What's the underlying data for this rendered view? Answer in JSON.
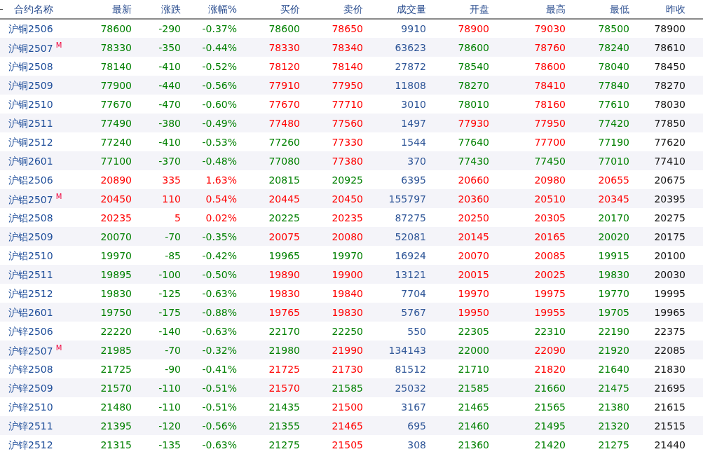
{
  "columns": [
    {
      "label": "合约名称",
      "kind": "name"
    },
    {
      "label": "最新",
      "kind": "price"
    },
    {
      "label": "涨跌",
      "kind": "price"
    },
    {
      "label": "涨幅%",
      "kind": "price"
    },
    {
      "label": "买价",
      "kind": "price"
    },
    {
      "label": "卖价",
      "kind": "price"
    },
    {
      "label": "成交量",
      "kind": "volume"
    },
    {
      "label": "开盘",
      "kind": "price"
    },
    {
      "label": "最高",
      "kind": "price"
    },
    {
      "label": "最低",
      "kind": "price"
    },
    {
      "label": "昨收",
      "kind": "close"
    }
  ],
  "rows": [
    {
      "name": "沪铜2506",
      "cells": [
        {
          "text": "78600",
          "color": "#008000"
        },
        {
          "text": "-290",
          "color": "#008000"
        },
        {
          "text": "-0.37%",
          "color": "#008000"
        },
        {
          "text": "78600",
          "color": "#008000"
        },
        {
          "text": "78650",
          "color": "#ff0000"
        },
        {
          "text": "9910"
        },
        {
          "text": "78900",
          "color": "#ff0000"
        },
        {
          "text": "79030",
          "color": "#ff0000"
        },
        {
          "text": "78500",
          "color": "#008000"
        },
        {
          "text": "78900"
        }
      ]
    },
    {
      "name": "沪铜2507",
      "marker": "M",
      "cells": [
        {
          "text": "78330",
          "color": "#008000"
        },
        {
          "text": "-350",
          "color": "#008000"
        },
        {
          "text": "-0.44%",
          "color": "#008000"
        },
        {
          "text": "78330",
          "color": "#ff0000"
        },
        {
          "text": "78340",
          "color": "#ff0000"
        },
        {
          "text": "63623"
        },
        {
          "text": "78600",
          "color": "#008000"
        },
        {
          "text": "78760",
          "color": "#ff0000"
        },
        {
          "text": "78240",
          "color": "#008000"
        },
        {
          "text": "78610"
        }
      ]
    },
    {
      "name": "沪铜2508",
      "cells": [
        {
          "text": "78140",
          "color": "#008000"
        },
        {
          "text": "-410",
          "color": "#008000"
        },
        {
          "text": "-0.52%",
          "color": "#008000"
        },
        {
          "text": "78120",
          "color": "#ff0000"
        },
        {
          "text": "78140",
          "color": "#ff0000"
        },
        {
          "text": "27872"
        },
        {
          "text": "78540",
          "color": "#008000"
        },
        {
          "text": "78600",
          "color": "#ff0000"
        },
        {
          "text": "78040",
          "color": "#008000"
        },
        {
          "text": "78450"
        }
      ]
    },
    {
      "name": "沪铜2509",
      "cells": [
        {
          "text": "77900",
          "color": "#008000"
        },
        {
          "text": "-440",
          "color": "#008000"
        },
        {
          "text": "-0.56%",
          "color": "#008000"
        },
        {
          "text": "77910",
          "color": "#ff0000"
        },
        {
          "text": "77950",
          "color": "#ff0000"
        },
        {
          "text": "11808"
        },
        {
          "text": "78270",
          "color": "#008000"
        },
        {
          "text": "78410",
          "color": "#ff0000"
        },
        {
          "text": "77840",
          "color": "#008000"
        },
        {
          "text": "78270"
        }
      ]
    },
    {
      "name": "沪铜2510",
      "cells": [
        {
          "text": "77670",
          "color": "#008000"
        },
        {
          "text": "-470",
          "color": "#008000"
        },
        {
          "text": "-0.60%",
          "color": "#008000"
        },
        {
          "text": "77670",
          "color": "#ff0000"
        },
        {
          "text": "77710",
          "color": "#ff0000"
        },
        {
          "text": "3010"
        },
        {
          "text": "78010",
          "color": "#008000"
        },
        {
          "text": "78160",
          "color": "#ff0000"
        },
        {
          "text": "77610",
          "color": "#008000"
        },
        {
          "text": "78030"
        }
      ]
    },
    {
      "name": "沪铜2511",
      "cells": [
        {
          "text": "77490",
          "color": "#008000"
        },
        {
          "text": "-380",
          "color": "#008000"
        },
        {
          "text": "-0.49%",
          "color": "#008000"
        },
        {
          "text": "77480",
          "color": "#ff0000"
        },
        {
          "text": "77560",
          "color": "#ff0000"
        },
        {
          "text": "1497"
        },
        {
          "text": "77930",
          "color": "#ff0000"
        },
        {
          "text": "77950",
          "color": "#ff0000"
        },
        {
          "text": "77420",
          "color": "#008000"
        },
        {
          "text": "77850"
        }
      ]
    },
    {
      "name": "沪铜2512",
      "cells": [
        {
          "text": "77240",
          "color": "#008000"
        },
        {
          "text": "-410",
          "color": "#008000"
        },
        {
          "text": "-0.53%",
          "color": "#008000"
        },
        {
          "text": "77260",
          "color": "#008000"
        },
        {
          "text": "77330",
          "color": "#ff0000"
        },
        {
          "text": "1544"
        },
        {
          "text": "77640",
          "color": "#008000"
        },
        {
          "text": "77700",
          "color": "#ff0000"
        },
        {
          "text": "77190",
          "color": "#008000"
        },
        {
          "text": "77620"
        }
      ]
    },
    {
      "name": "沪铜2601",
      "cells": [
        {
          "text": "77100",
          "color": "#008000"
        },
        {
          "text": "-370",
          "color": "#008000"
        },
        {
          "text": "-0.48%",
          "color": "#008000"
        },
        {
          "text": "77080",
          "color": "#008000"
        },
        {
          "text": "77380",
          "color": "#ff0000"
        },
        {
          "text": "370"
        },
        {
          "text": "77430",
          "color": "#008000"
        },
        {
          "text": "77450",
          "color": "#008000"
        },
        {
          "text": "77010",
          "color": "#008000"
        },
        {
          "text": "77410"
        }
      ]
    },
    {
      "name": "沪铝2506",
      "cells": [
        {
          "text": "20890",
          "color": "#ff0000"
        },
        {
          "text": "335",
          "color": "#ff0000"
        },
        {
          "text": "1.63%",
          "color": "#ff0000"
        },
        {
          "text": "20815",
          "color": "#008000"
        },
        {
          "text": "20925",
          "color": "#008000"
        },
        {
          "text": "6395"
        },
        {
          "text": "20660",
          "color": "#ff0000"
        },
        {
          "text": "20980",
          "color": "#ff0000"
        },
        {
          "text": "20655",
          "color": "#ff0000"
        },
        {
          "text": "20675"
        }
      ]
    },
    {
      "name": "沪铝2507",
      "marker": "M",
      "cells": [
        {
          "text": "20450",
          "color": "#ff0000"
        },
        {
          "text": "110",
          "color": "#ff0000"
        },
        {
          "text": "0.54%",
          "color": "#ff0000"
        },
        {
          "text": "20445",
          "color": "#ff0000"
        },
        {
          "text": "20450",
          "color": "#ff0000"
        },
        {
          "text": "155797"
        },
        {
          "text": "20360",
          "color": "#ff0000"
        },
        {
          "text": "20510",
          "color": "#ff0000"
        },
        {
          "text": "20345",
          "color": "#ff0000"
        },
        {
          "text": "20395"
        }
      ]
    },
    {
      "name": "沪铝2508",
      "cells": [
        {
          "text": "20235",
          "color": "#ff0000"
        },
        {
          "text": "5",
          "color": "#ff0000"
        },
        {
          "text": "0.02%",
          "color": "#ff0000"
        },
        {
          "text": "20225",
          "color": "#008000"
        },
        {
          "text": "20235",
          "color": "#ff0000"
        },
        {
          "text": "87275"
        },
        {
          "text": "20250",
          "color": "#ff0000"
        },
        {
          "text": "20305",
          "color": "#ff0000"
        },
        {
          "text": "20170",
          "color": "#008000"
        },
        {
          "text": "20275"
        }
      ]
    },
    {
      "name": "沪铝2509",
      "cells": [
        {
          "text": "20070",
          "color": "#008000"
        },
        {
          "text": "-70",
          "color": "#008000"
        },
        {
          "text": "-0.35%",
          "color": "#008000"
        },
        {
          "text": "20075",
          "color": "#ff0000"
        },
        {
          "text": "20080",
          "color": "#ff0000"
        },
        {
          "text": "52081"
        },
        {
          "text": "20145",
          "color": "#ff0000"
        },
        {
          "text": "20165",
          "color": "#ff0000"
        },
        {
          "text": "20020",
          "color": "#008000"
        },
        {
          "text": "20175"
        }
      ]
    },
    {
      "name": "沪铝2510",
      "cells": [
        {
          "text": "19970",
          "color": "#008000"
        },
        {
          "text": "-85",
          "color": "#008000"
        },
        {
          "text": "-0.42%",
          "color": "#008000"
        },
        {
          "text": "19965",
          "color": "#008000"
        },
        {
          "text": "19970",
          "color": "#008000"
        },
        {
          "text": "16924"
        },
        {
          "text": "20070",
          "color": "#ff0000"
        },
        {
          "text": "20085",
          "color": "#ff0000"
        },
        {
          "text": "19915",
          "color": "#008000"
        },
        {
          "text": "20100"
        }
      ]
    },
    {
      "name": "沪铝2511",
      "cells": [
        {
          "text": "19895",
          "color": "#008000"
        },
        {
          "text": "-100",
          "color": "#008000"
        },
        {
          "text": "-0.50%",
          "color": "#008000"
        },
        {
          "text": "19890",
          "color": "#ff0000"
        },
        {
          "text": "19900",
          "color": "#ff0000"
        },
        {
          "text": "13121"
        },
        {
          "text": "20015",
          "color": "#ff0000"
        },
        {
          "text": "20025",
          "color": "#ff0000"
        },
        {
          "text": "19830",
          "color": "#008000"
        },
        {
          "text": "20030"
        }
      ]
    },
    {
      "name": "沪铝2512",
      "cells": [
        {
          "text": "19830",
          "color": "#008000"
        },
        {
          "text": "-125",
          "color": "#008000"
        },
        {
          "text": "-0.63%",
          "color": "#008000"
        },
        {
          "text": "19830",
          "color": "#ff0000"
        },
        {
          "text": "19840",
          "color": "#ff0000"
        },
        {
          "text": "7704"
        },
        {
          "text": "19970",
          "color": "#ff0000"
        },
        {
          "text": "19975",
          "color": "#ff0000"
        },
        {
          "text": "19770",
          "color": "#008000"
        },
        {
          "text": "19995"
        }
      ]
    },
    {
      "name": "沪铝2601",
      "cells": [
        {
          "text": "19750",
          "color": "#008000"
        },
        {
          "text": "-175",
          "color": "#008000"
        },
        {
          "text": "-0.88%",
          "color": "#008000"
        },
        {
          "text": "19765",
          "color": "#ff0000"
        },
        {
          "text": "19830",
          "color": "#ff0000"
        },
        {
          "text": "5767"
        },
        {
          "text": "19950",
          "color": "#ff0000"
        },
        {
          "text": "19955",
          "color": "#ff0000"
        },
        {
          "text": "19705",
          "color": "#008000"
        },
        {
          "text": "19965"
        }
      ]
    },
    {
      "name": "沪锌2506",
      "cells": [
        {
          "text": "22220",
          "color": "#008000"
        },
        {
          "text": "-140",
          "color": "#008000"
        },
        {
          "text": "-0.63%",
          "color": "#008000"
        },
        {
          "text": "22170",
          "color": "#008000"
        },
        {
          "text": "22250",
          "color": "#008000"
        },
        {
          "text": "550"
        },
        {
          "text": "22305",
          "color": "#008000"
        },
        {
          "text": "22310",
          "color": "#008000"
        },
        {
          "text": "22190",
          "color": "#008000"
        },
        {
          "text": "22375"
        }
      ]
    },
    {
      "name": "沪锌2507",
      "marker": "M",
      "cells": [
        {
          "text": "21985",
          "color": "#008000"
        },
        {
          "text": "-70",
          "color": "#008000"
        },
        {
          "text": "-0.32%",
          "color": "#008000"
        },
        {
          "text": "21980",
          "color": "#008000"
        },
        {
          "text": "21990",
          "color": "#ff0000"
        },
        {
          "text": "134143"
        },
        {
          "text": "22000",
          "color": "#008000"
        },
        {
          "text": "22090",
          "color": "#ff0000"
        },
        {
          "text": "21920",
          "color": "#008000"
        },
        {
          "text": "22085"
        }
      ]
    },
    {
      "name": "沪锌2508",
      "cells": [
        {
          "text": "21725",
          "color": "#008000"
        },
        {
          "text": "-90",
          "color": "#008000"
        },
        {
          "text": "-0.41%",
          "color": "#008000"
        },
        {
          "text": "21725",
          "color": "#ff0000"
        },
        {
          "text": "21730",
          "color": "#ff0000"
        },
        {
          "text": "81512"
        },
        {
          "text": "21710",
          "color": "#008000"
        },
        {
          "text": "21820",
          "color": "#ff0000"
        },
        {
          "text": "21640",
          "color": "#008000"
        },
        {
          "text": "21830"
        }
      ]
    },
    {
      "name": "沪锌2509",
      "cells": [
        {
          "text": "21570",
          "color": "#008000"
        },
        {
          "text": "-110",
          "color": "#008000"
        },
        {
          "text": "-0.51%",
          "color": "#008000"
        },
        {
          "text": "21570",
          "color": "#ff0000"
        },
        {
          "text": "21585",
          "color": "#008000"
        },
        {
          "text": "25032"
        },
        {
          "text": "21585",
          "color": "#008000"
        },
        {
          "text": "21660",
          "color": "#008000"
        },
        {
          "text": "21475",
          "color": "#008000"
        },
        {
          "text": "21695"
        }
      ]
    },
    {
      "name": "沪锌2510",
      "cells": [
        {
          "text": "21480",
          "color": "#008000"
        },
        {
          "text": "-110",
          "color": "#008000"
        },
        {
          "text": "-0.51%",
          "color": "#008000"
        },
        {
          "text": "21435",
          "color": "#008000"
        },
        {
          "text": "21500",
          "color": "#ff0000"
        },
        {
          "text": "3167"
        },
        {
          "text": "21465",
          "color": "#008000"
        },
        {
          "text": "21565",
          "color": "#008000"
        },
        {
          "text": "21380",
          "color": "#008000"
        },
        {
          "text": "21615"
        }
      ]
    },
    {
      "name": "沪锌2511",
      "cells": [
        {
          "text": "21395",
          "color": "#008000"
        },
        {
          "text": "-120",
          "color": "#008000"
        },
        {
          "text": "-0.56%",
          "color": "#008000"
        },
        {
          "text": "21355",
          "color": "#008000"
        },
        {
          "text": "21465",
          "color": "#ff0000"
        },
        {
          "text": "695"
        },
        {
          "text": "21460",
          "color": "#008000"
        },
        {
          "text": "21495",
          "color": "#008000"
        },
        {
          "text": "21320",
          "color": "#008000"
        },
        {
          "text": "21515"
        }
      ]
    },
    {
      "name": "沪锌2512",
      "cells": [
        {
          "text": "21315",
          "color": "#008000"
        },
        {
          "text": "-135",
          "color": "#008000"
        },
        {
          "text": "-0.63%",
          "color": "#008000"
        },
        {
          "text": "21275",
          "color": "#008000"
        },
        {
          "text": "21505",
          "color": "#ff0000"
        },
        {
          "text": "308"
        },
        {
          "text": "21360",
          "color": "#008000"
        },
        {
          "text": "21420",
          "color": "#008000"
        },
        {
          "text": "21275",
          "color": "#008000"
        },
        {
          "text": "21440"
        }
      ]
    }
  ]
}
